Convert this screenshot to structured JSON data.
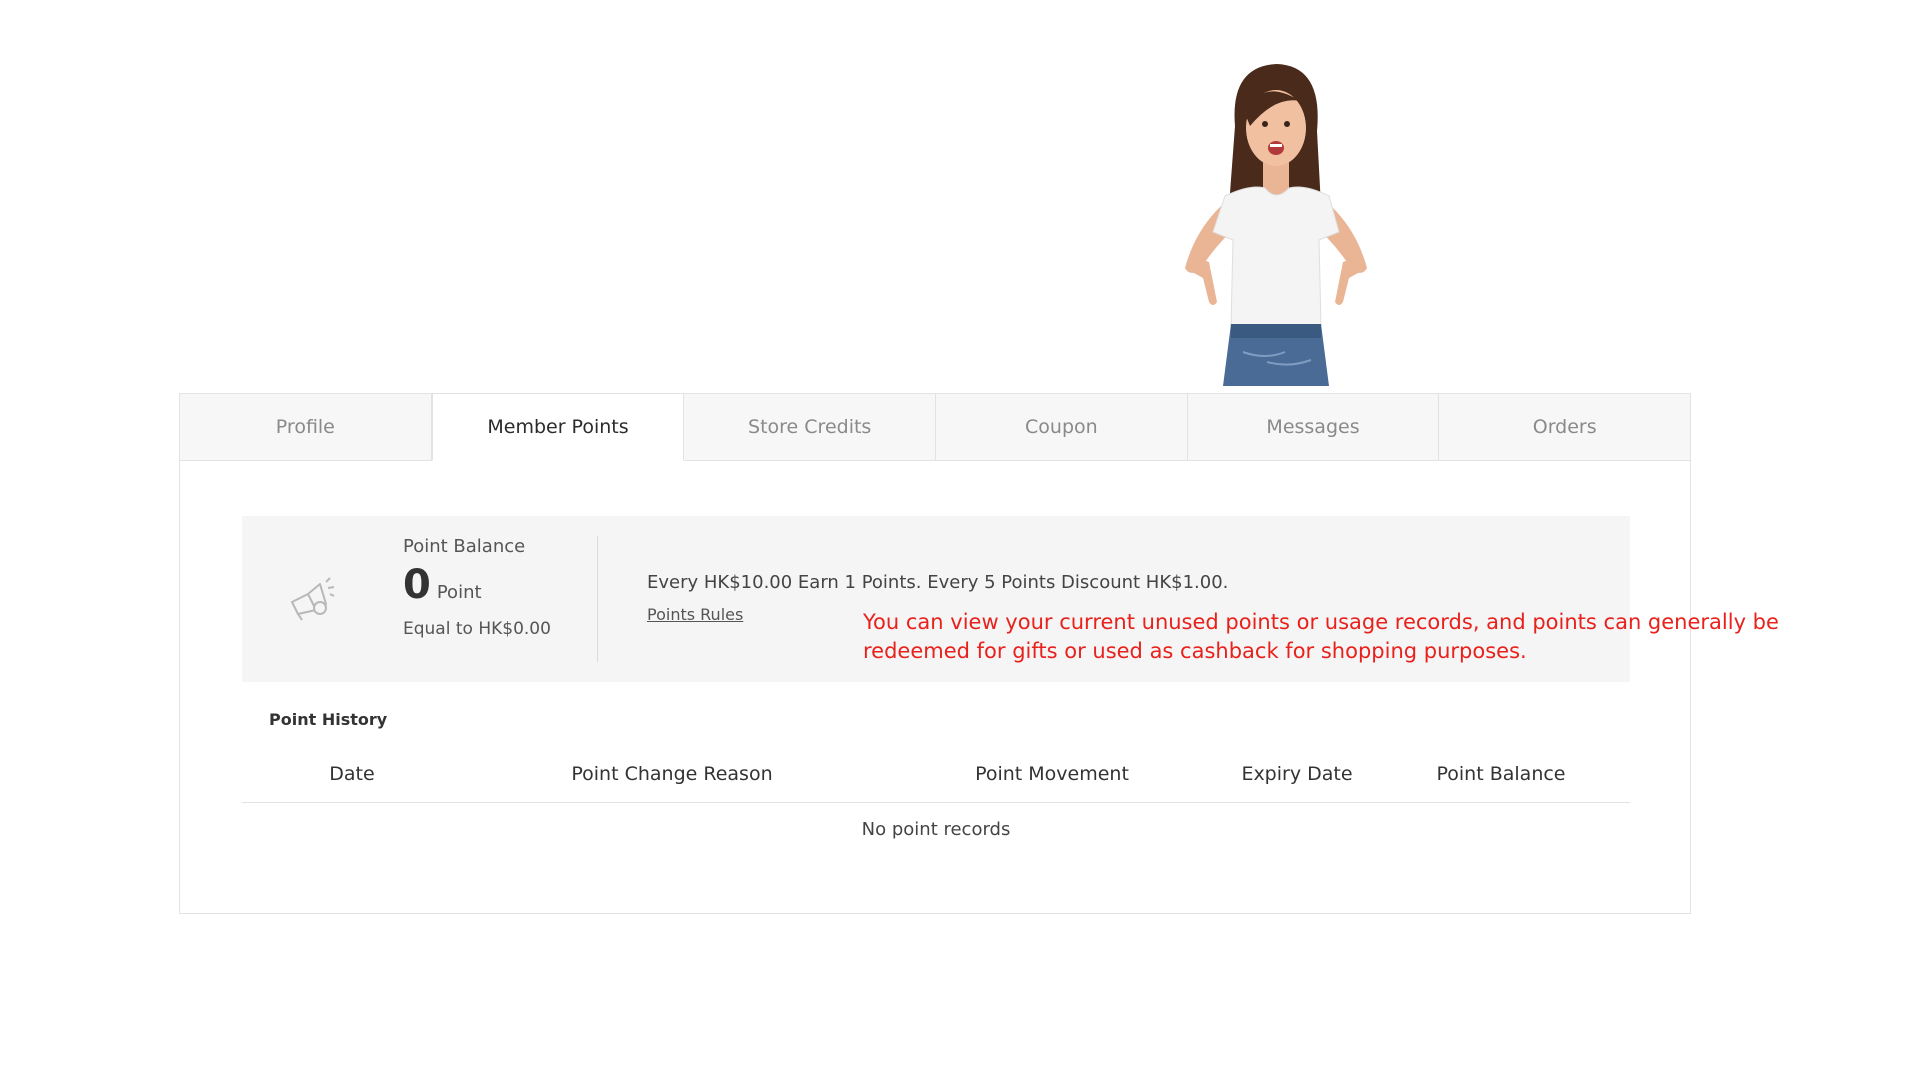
{
  "tabs": [
    {
      "label": "Profile"
    },
    {
      "label": "Member Points"
    },
    {
      "label": "Store Credits"
    },
    {
      "label": "Coupon"
    },
    {
      "label": "Messages"
    },
    {
      "label": "Orders"
    }
  ],
  "balance": {
    "label": "Point Balance",
    "value": "0",
    "unit": "Point",
    "equal": "Equal to HK$0.00"
  },
  "rules": {
    "text": "Every HK$10.00 Earn 1 Points. Every 5 Points Discount HK$1.00.",
    "link": "Points Rules"
  },
  "history": {
    "title": "Point History",
    "columns": [
      "Date",
      "Point Change Reason",
      "Point Movement",
      "Expiry Date",
      "Point Balance"
    ],
    "empty": "No point records"
  },
  "annotation": "You can view your current unused points or usage records, and points can generally be redeemed for gifts or used as cashback for shopping purposes.",
  "colors": {
    "annotation": "#e8211c",
    "panel_border": "#e3e3e3",
    "balance_bg": "#f5f5f5"
  }
}
